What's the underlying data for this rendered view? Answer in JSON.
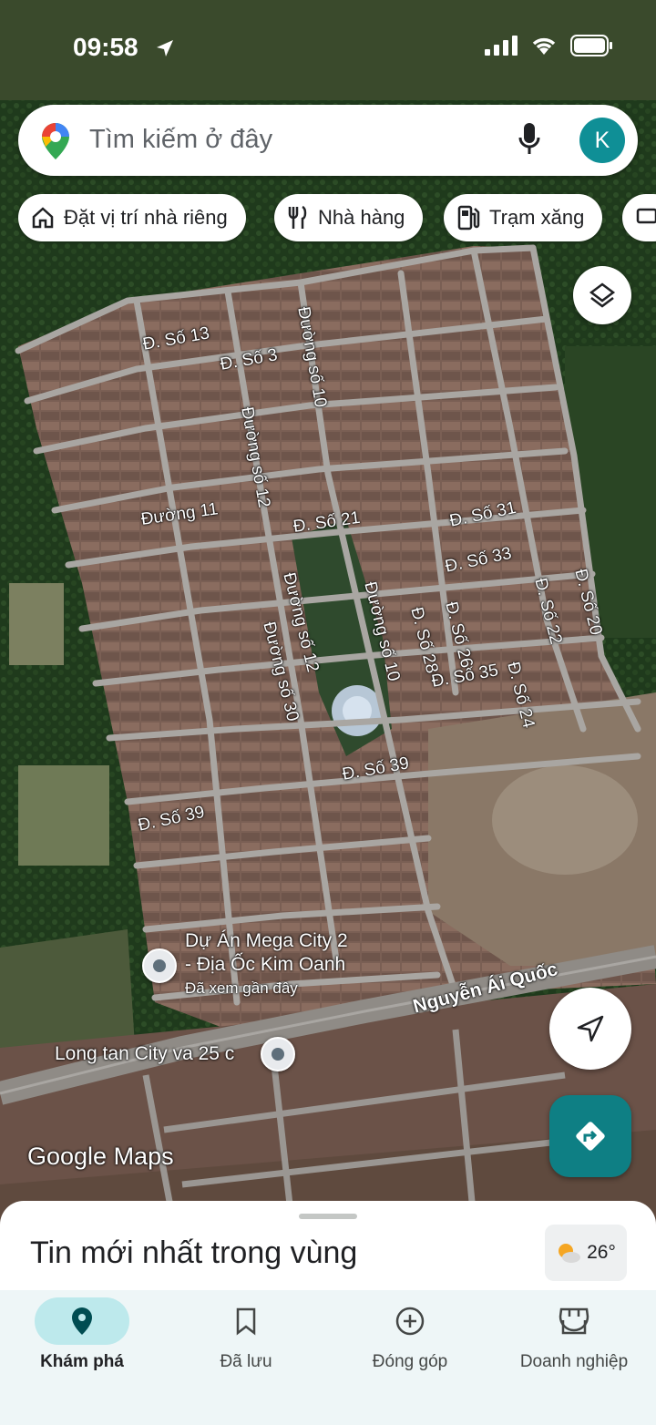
{
  "status": {
    "time": "09:58"
  },
  "search": {
    "placeholder": "Tìm kiếm ở đây",
    "avatar_letter": "K"
  },
  "chips": [
    {
      "label": "Đặt vị trí nhà riêng",
      "icon": "home-icon"
    },
    {
      "label": "Nhà hàng",
      "icon": "restaurant-icon"
    },
    {
      "label": "Trạm xăng",
      "icon": "gas-station-icon"
    }
  ],
  "map": {
    "road_labels": [
      "Đ. Số 13",
      "Đ. Số 3",
      "Đường số 10",
      "Đường số 12",
      "Đường 11",
      "Đ. Số 21",
      "Đ. Số 31",
      "Đ. Số 33",
      "Đường số 12",
      "Đường số 10",
      "Đ. Số 28",
      "Đ. Số 26",
      "Đ. Số 22",
      "Đ. Số 20",
      "Đường số 30",
      "Đ. Số 35",
      "Đ. Số 24",
      "Đ. Số 39",
      "Đ. Số 39",
      "Nguyễn Ái Quốc"
    ],
    "places": [
      {
        "name_line1": "Dự Án Mega City 2",
        "name_line2": "- Địa Ốc Kim Oanh",
        "note": "Đã xem gần đây"
      },
      {
        "name_line1": "Long tan City va 25 c"
      }
    ],
    "attribution": "Google Maps"
  },
  "sheet": {
    "title": "Tin mới nhất trong vùng",
    "temperature": "26°"
  },
  "nav": [
    {
      "label": "Khám phá",
      "icon": "explore-pin-icon",
      "active": true
    },
    {
      "label": "Đã lưu",
      "icon": "bookmark-icon",
      "active": false
    },
    {
      "label": "Đóng góp",
      "icon": "add-circle-icon",
      "active": false
    },
    {
      "label": "Doanh nghiệp",
      "icon": "storefront-icon",
      "active": false
    }
  ]
}
